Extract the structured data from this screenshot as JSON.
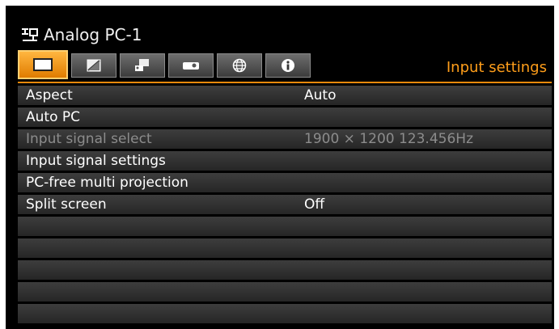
{
  "header": {
    "source_icon": "input-source-icon",
    "source_name": "Analog PC-1",
    "section_title": "Input settings"
  },
  "tabs": [
    {
      "icon": "input-settings-icon",
      "active": true
    },
    {
      "icon": "image-adjust-icon",
      "active": false
    },
    {
      "icon": "install-settings-icon",
      "active": false
    },
    {
      "icon": "system-settings-icon",
      "active": false
    },
    {
      "icon": "network-icon",
      "active": false
    },
    {
      "icon": "information-icon",
      "active": false
    }
  ],
  "menu": {
    "items": [
      {
        "label": "Aspect",
        "value": "Auto",
        "enabled": true
      },
      {
        "label": "Auto PC",
        "value": "",
        "enabled": true
      },
      {
        "label": "Input signal select",
        "value": "1900 × 1200 123.456Hz",
        "enabled": false
      },
      {
        "label": "Input signal settings",
        "value": "",
        "enabled": true
      },
      {
        "label": "PC-free multi projection",
        "value": "",
        "enabled": true
      },
      {
        "label": "Split screen",
        "value": "Off",
        "enabled": true
      },
      {
        "label": "",
        "value": "",
        "enabled": true
      },
      {
        "label": "",
        "value": "",
        "enabled": true
      },
      {
        "label": "",
        "value": "",
        "enabled": true
      },
      {
        "label": "",
        "value": "",
        "enabled": true
      },
      {
        "label": "",
        "value": "",
        "enabled": true
      }
    ]
  },
  "colors": {
    "accent": "#ff9e1a",
    "active_tab": "#f39a1e",
    "background": "#000000",
    "row": "#333333",
    "disabled_text": "#8c8c8c"
  }
}
